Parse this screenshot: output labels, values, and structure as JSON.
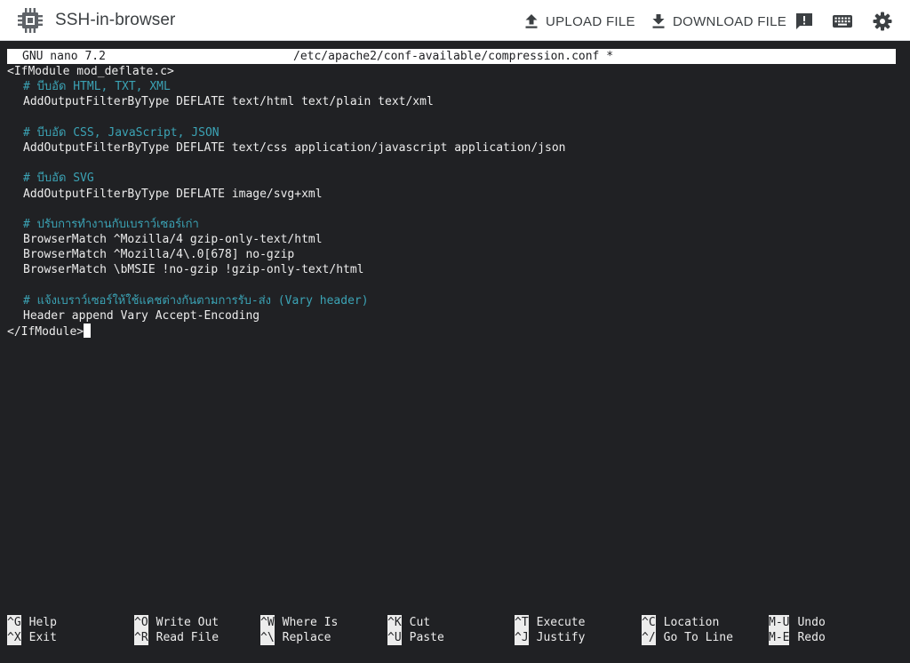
{
  "app": {
    "title": "SSH-in-browser",
    "upload_label": "UPLOAD FILE",
    "download_label": "DOWNLOAD FILE",
    "icons": [
      "chip-logo-icon",
      "upload-icon",
      "download-icon",
      "feedback-icon",
      "keyboard-icon",
      "settings-icon"
    ]
  },
  "nano": {
    "version": "GNU nano 7.2",
    "file": "/etc/apache2/conf-available/compression.conf *"
  },
  "lines": [
    {
      "indent": false,
      "comment": false,
      "text": "<IfModule mod_deflate.c>"
    },
    {
      "indent": true,
      "comment": true,
      "text": "# บีบอัด HTML, TXT, XML"
    },
    {
      "indent": true,
      "comment": false,
      "text": "AddOutputFilterByType DEFLATE text/html text/plain text/xml"
    },
    {
      "indent": false,
      "comment": false,
      "text": ""
    },
    {
      "indent": true,
      "comment": true,
      "text": "# บีบอัด CSS, JavaScript, JSON"
    },
    {
      "indent": true,
      "comment": false,
      "text": "AddOutputFilterByType DEFLATE text/css application/javascript application/json"
    },
    {
      "indent": false,
      "comment": false,
      "text": ""
    },
    {
      "indent": true,
      "comment": true,
      "text": "# บีบอัด SVG"
    },
    {
      "indent": true,
      "comment": false,
      "text": "AddOutputFilterByType DEFLATE image/svg+xml"
    },
    {
      "indent": false,
      "comment": false,
      "text": ""
    },
    {
      "indent": true,
      "comment": true,
      "text": "# ปรับการทำงานกับเบราว์เซอร์เก่า"
    },
    {
      "indent": true,
      "comment": false,
      "text": "BrowserMatch ^Mozilla/4 gzip-only-text/html"
    },
    {
      "indent": true,
      "comment": false,
      "text": "BrowserMatch ^Mozilla/4\\.0[678] no-gzip"
    },
    {
      "indent": true,
      "comment": false,
      "text": "BrowserMatch \\bMSIE !no-gzip !gzip-only-text/html"
    },
    {
      "indent": false,
      "comment": false,
      "text": ""
    },
    {
      "indent": true,
      "comment": true,
      "text": "# แจ้งเบราว์เซอร์ให้ใช้แคชต่างกันตามการรับ-ส่ง (Vary header)"
    },
    {
      "indent": true,
      "comment": false,
      "text": "Header append Vary Accept-Encoding"
    },
    {
      "indent": false,
      "comment": false,
      "text": "</IfModule>",
      "cursor": true
    }
  ],
  "shortcuts": [
    [
      {
        "key": "^G",
        "label": "Help"
      },
      {
        "key": "^O",
        "label": "Write Out"
      },
      {
        "key": "^W",
        "label": "Where Is"
      },
      {
        "key": "^K",
        "label": "Cut"
      },
      {
        "key": "^T",
        "label": "Execute"
      },
      {
        "key": "^C",
        "label": "Location"
      },
      {
        "key": "M-U",
        "label": "Undo"
      }
    ],
    [
      {
        "key": "^X",
        "label": "Exit"
      },
      {
        "key": "^R",
        "label": "Read File"
      },
      {
        "key": "^\\",
        "label": "Replace"
      },
      {
        "key": "^U",
        "label": "Paste"
      },
      {
        "key": "^J",
        "label": "Justify"
      },
      {
        "key": "^/",
        "label": "Go To Line"
      },
      {
        "key": "M-E",
        "label": "Redo"
      }
    ]
  ]
}
